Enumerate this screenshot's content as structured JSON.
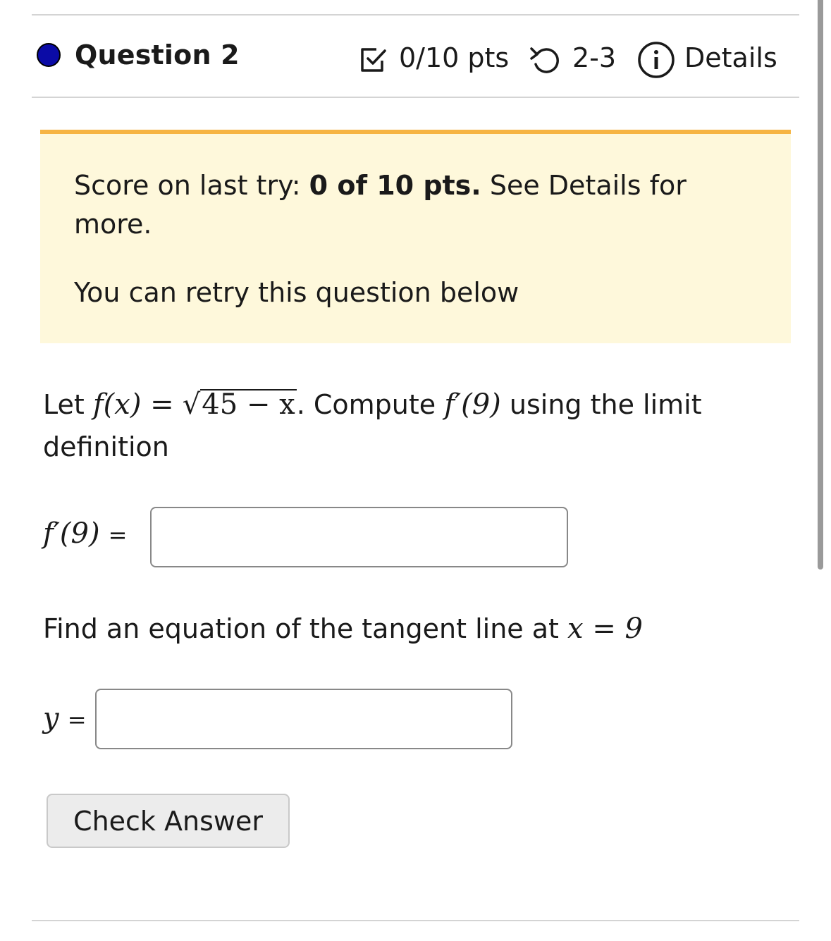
{
  "header": {
    "question_title": "Question 2",
    "points": "0/10 pts",
    "attempts": "2-3",
    "details_label": "Details",
    "icons": {
      "status": "filled-dot-icon",
      "points": "checkbox-icon",
      "attempts": "retry-icon",
      "details": "info-icon"
    },
    "status_color": "#0b0ba6"
  },
  "notice": {
    "score_prefix": "Score on last try: ",
    "score_bold": "0 of 10 pts.",
    "score_suffix": " See Details for",
    "score_wrap": "more.",
    "retry_text": "You can retry this question below",
    "accent_color": "#f6b443",
    "background_color": "#fef8db"
  },
  "problem": {
    "intro_let": "Let",
    "func_lhs": "f(x) =",
    "radicand": "45 − x",
    "after_func": ". Compute",
    "derivative_expr": "f′(9)",
    "after_derivative": "using the limit",
    "wrap_text": "definition",
    "answer1_label_math": "f′(9)",
    "answer1_label_eq": "=",
    "tangent_prompt": "Find an equation of the tangent line at",
    "tangent_math": "x = 9",
    "answer2_label_math": "y",
    "answer2_label_eq": "="
  },
  "actions": {
    "check_answer": "Check Answer"
  }
}
